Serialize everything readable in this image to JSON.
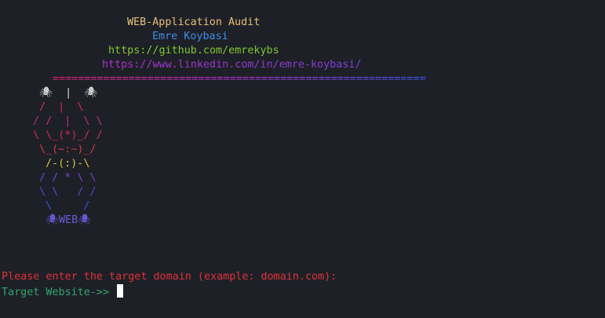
{
  "colors": {
    "background": "#1e2027",
    "title": "#e5c07b",
    "author": "#3b8eea",
    "github": "#7ec832",
    "linkedin_a": "#b031c9",
    "linkedin_b": "#7c3fd8",
    "rule_a": "#d6246c",
    "rule_b": "#3a55e8",
    "prompt": "#e0303a",
    "input_label": "#2fa66d",
    "cursor": "#ffffff",
    "web_label": "#6a5cd8"
  },
  "header": {
    "title": "WEB-Application Audit",
    "author": "Emre Koybasi",
    "github": "https://github.com/emrekybs",
    "linkedin": "https://www.linkedin.com/in/emre-koybasi/",
    "rule": "==========================================================="
  },
  "banner": {
    "lines": [
      "🕷  |  🕷",
      "/  |  \\",
      "/ /  |  \\ \\",
      "\\ \\_(*)_/ /",
      "\\_(~:~)_/",
      "/-(:)-\\",
      "/ / * \\ \\",
      "\\ \\   / /",
      "\\     /",
      "🕷WEB🕷"
    ],
    "label": "WEB"
  },
  "prompt": {
    "message": "Please enter the target domain (example: domain.com):",
    "input_label": "Target Website->> ",
    "input_value": ""
  }
}
